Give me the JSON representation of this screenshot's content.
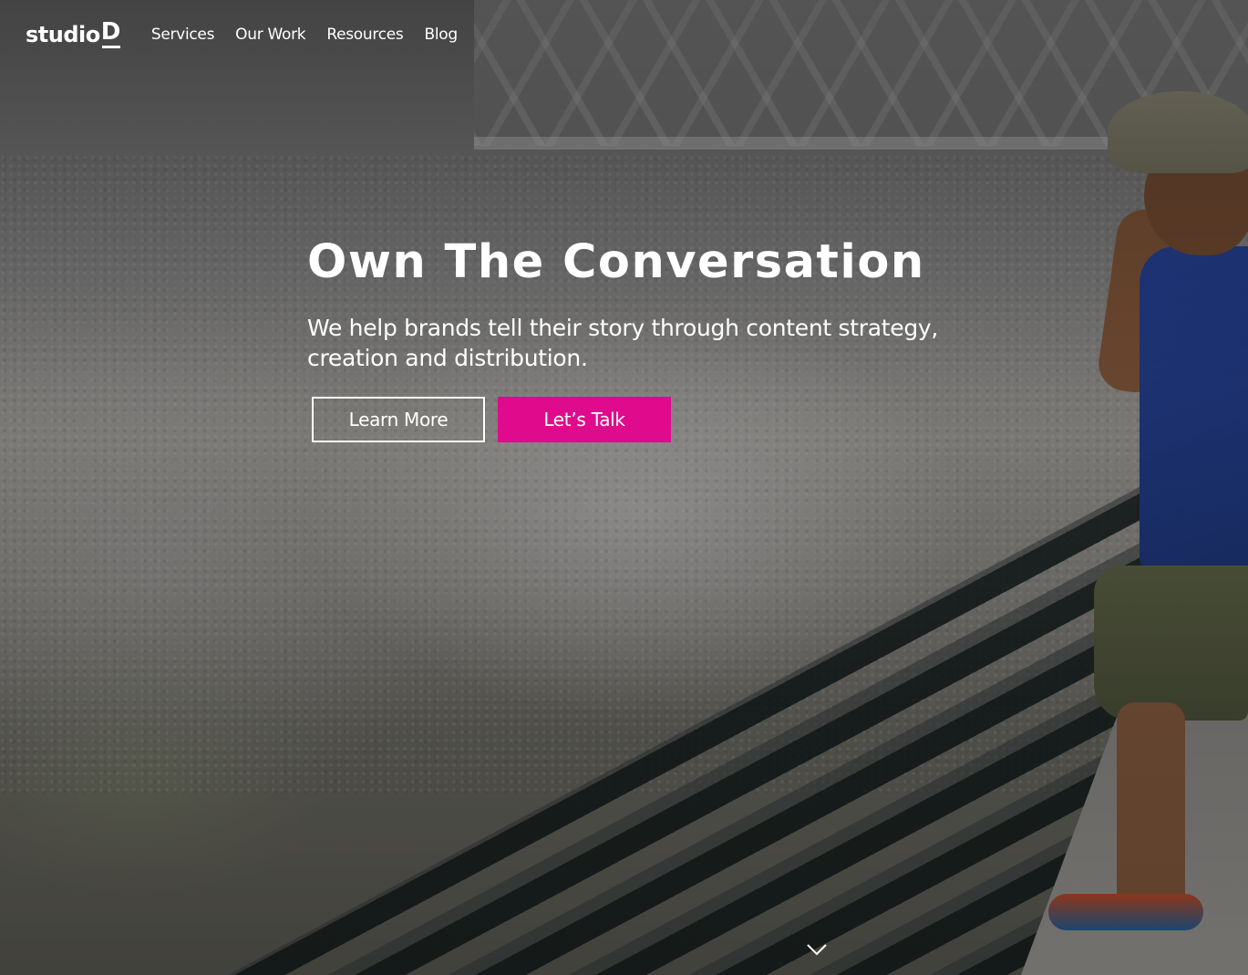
{
  "logo": {
    "text": "studio",
    "letter": "D"
  },
  "nav": {
    "items": [
      {
        "label": "Services"
      },
      {
        "label": "Our Work"
      },
      {
        "label": "Resources"
      },
      {
        "label": "Blog"
      }
    ]
  },
  "hero": {
    "title": "Own The Conversation",
    "subtitle": "We help brands tell their story through content strategy, creation and distribution.",
    "buttons": {
      "learn_more": "Learn More",
      "lets_talk": "Let’s Talk"
    },
    "scroll_icon": "chevron-down-icon"
  },
  "colors": {
    "accent": "#e00a8c",
    "text": "#ffffff"
  }
}
